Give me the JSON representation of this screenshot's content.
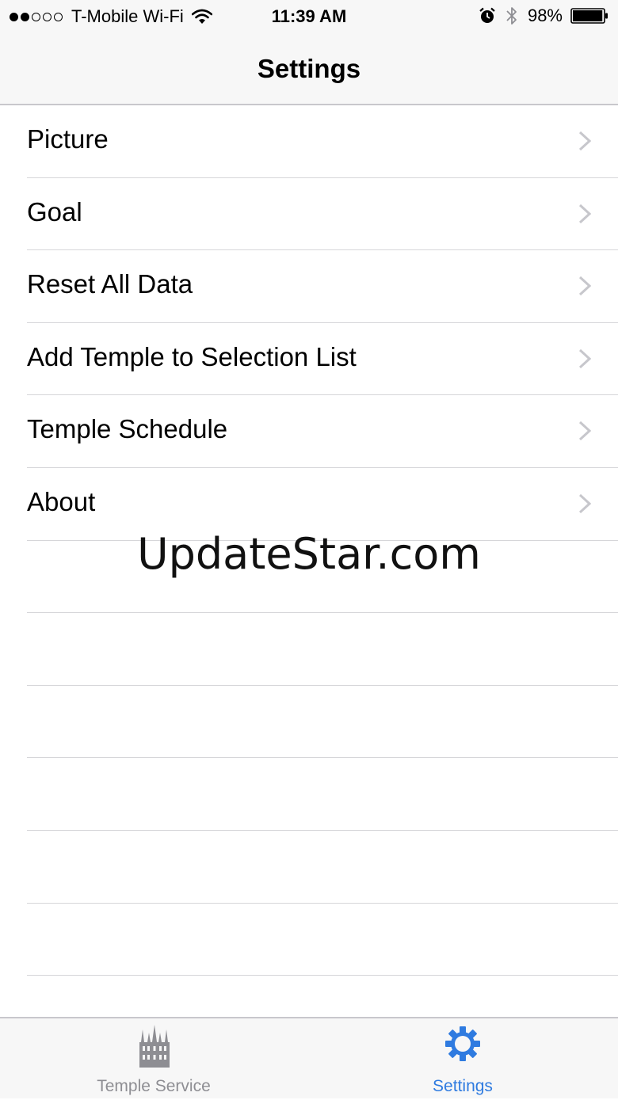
{
  "status_bar": {
    "signal": {
      "filled": 2,
      "total": 5
    },
    "carrier": "T-Mobile Wi-Fi",
    "time": "11:39 AM",
    "battery_percent": "98%",
    "battery_level": 0.98,
    "icons": [
      "wifi-icon",
      "alarm-icon",
      "bluetooth-icon",
      "battery-icon"
    ]
  },
  "header": {
    "title": "Settings"
  },
  "settings_list": {
    "items": [
      {
        "label": "Picture"
      },
      {
        "label": "Goal"
      },
      {
        "label": "Reset All Data"
      },
      {
        "label": "Add Temple to Selection List"
      },
      {
        "label": "Temple Schedule"
      },
      {
        "label": "About"
      }
    ],
    "empty_rows": 7
  },
  "watermark": "UpdateStar.com",
  "tab_bar": {
    "tabs": [
      {
        "label": "Temple Service",
        "icon": "temple-icon",
        "selected": false
      },
      {
        "label": "Settings",
        "icon": "gear-icon",
        "selected": true
      }
    ]
  },
  "colors": {
    "accent": "#2f7be0",
    "inactive_tab": "#8e8e93",
    "separator": "#d6d6d9",
    "bar_background": "#f7f7f7",
    "chevron": "#c7c7cc"
  }
}
